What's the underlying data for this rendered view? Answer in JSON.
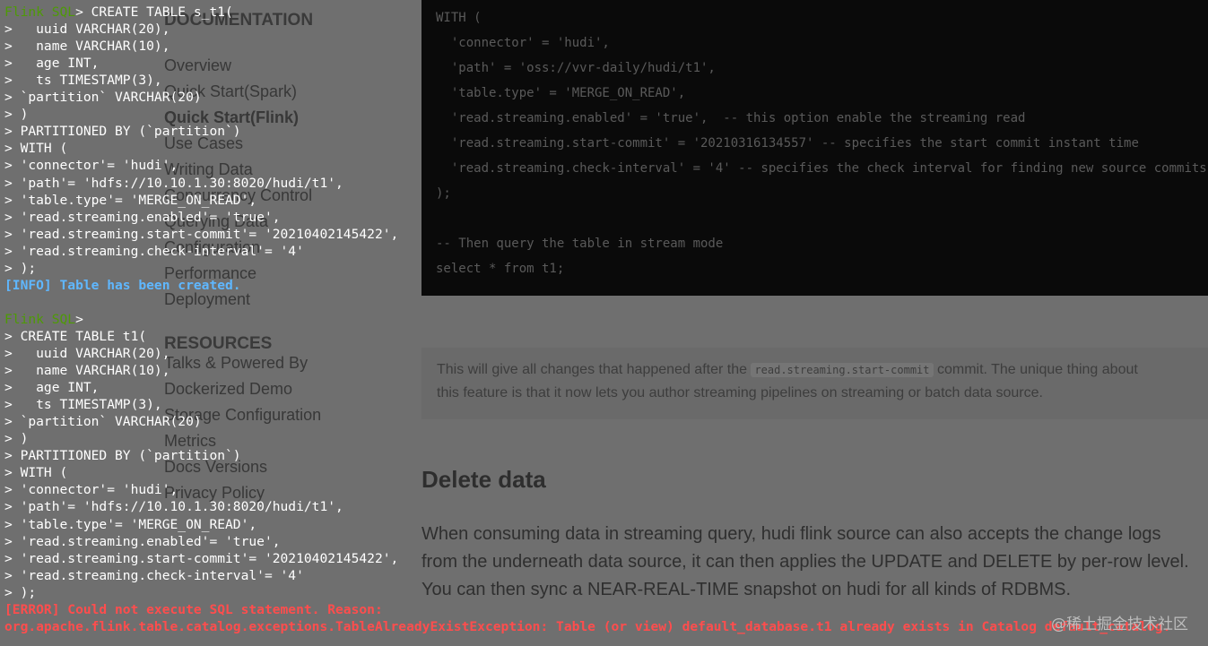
{
  "background_page": {
    "sidebar": {
      "documentation_heading": "DOCUMENTATION",
      "documentation_items": [
        "Overview",
        "Quick Start(Spark)",
        "Quick Start(Flink)",
        "Use Cases",
        "Writing Data",
        "Concurrency Control",
        "Querying Data",
        "Configuration",
        "Performance",
        "Deployment"
      ],
      "resources_heading": "RESOURCES",
      "resources_items": [
        "Talks & Powered By",
        "Dockerized Demo",
        "Storage Configuration",
        "Metrics",
        "Docs Versions",
        "Privacy Policy"
      ]
    },
    "code_lines": [
      "WITH (",
      "  'connector' = 'hudi',",
      "  'path' = 'oss://vvr-daily/hudi/t1',",
      "  'table.type' = 'MERGE_ON_READ',",
      "  'read.streaming.enabled' = 'true',  -- this option enable the streaming read",
      "  'read.streaming.start-commit' = '20210316134557' -- specifies the start commit instant time",
      "  'read.streaming.check-interval' = '4' -- specifies the check interval for finding new source commits",
      ");",
      "",
      "-- Then query the table in stream mode",
      "select * from t1;"
    ],
    "note": {
      "line1_before": "This will give all changes that happened after the ",
      "line1_code": "read.streaming.start-commit",
      "line1_after": " commit. The unique thing about",
      "line2": "this feature is that it now lets you author streaming pipelines on streaming or batch data source."
    },
    "section_heading": "Delete data",
    "paragraph_lines": [
      "When consuming data in streaming query, hudi flink source can also accepts the change logs",
      "from the underneath data source, it can then applies the UPDATE and DELETE by per-row level.",
      "You can then sync a NEAR-REAL-TIME snapshot on hudi for all kinds of RDBMS."
    ]
  },
  "terminal": {
    "prompt_label": "Flink SQL",
    "lines": [
      {
        "prompt": true,
        "text": "> CREATE TABLE s_t1("
      },
      {
        "text": ">   uuid VARCHAR(20),"
      },
      {
        "text": ">   name VARCHAR(10),"
      },
      {
        "text": ">   age INT,"
      },
      {
        "text": ">   ts TIMESTAMP(3),"
      },
      {
        "text": "> `partition` VARCHAR(20)"
      },
      {
        "text": "> )"
      },
      {
        "text": "> PARTITIONED BY (`partition`)"
      },
      {
        "text": "> WITH ("
      },
      {
        "text": "> 'connector'= 'hudi',"
      },
      {
        "text": "> 'path'= 'hdfs://10.10.1.30:8020/hudi/t1',"
      },
      {
        "text": "> 'table.type'= 'MERGE_ON_READ',"
      },
      {
        "text": "> 'read.streaming.enabled'= 'true',"
      },
      {
        "text": "> 'read.streaming.start-commit'= '20210402145422',"
      },
      {
        "text": "> 'read.streaming.check-interval'= '4'"
      },
      {
        "text": "> );"
      },
      {
        "kind": "info",
        "text": "[INFO] Table has been created."
      },
      {
        "text": ""
      },
      {
        "prompt": true,
        "text": ">"
      },
      {
        "text": "> CREATE TABLE t1("
      },
      {
        "text": ">   uuid VARCHAR(20),"
      },
      {
        "text": ">   name VARCHAR(10),"
      },
      {
        "text": ">   age INT,"
      },
      {
        "text": ">   ts TIMESTAMP(3),"
      },
      {
        "text": "> `partition` VARCHAR(20)"
      },
      {
        "text": "> )"
      },
      {
        "text": "> PARTITIONED BY (`partition`)"
      },
      {
        "text": "> WITH ("
      },
      {
        "text": "> 'connector'= 'hudi',"
      },
      {
        "text": "> 'path'= 'hdfs://10.10.1.30:8020/hudi/t1',"
      },
      {
        "text": "> 'table.type'= 'MERGE_ON_READ',"
      },
      {
        "text": "> 'read.streaming.enabled'= 'true',"
      },
      {
        "text": "> 'read.streaming.start-commit'= '20210402145422',"
      },
      {
        "text": "> 'read.streaming.check-interval'= '4'"
      },
      {
        "text": "> );"
      },
      {
        "kind": "error",
        "text": "[ERROR] Could not execute SQL statement. Reason:"
      },
      {
        "kind": "error",
        "text": "org.apache.flink.table.catalog.exceptions.TableAlreadyExistException: Table (or view) default_database.t1 already exists in Catalog default_catalog."
      }
    ]
  },
  "watermark": "@稀土掘金技术社区"
}
